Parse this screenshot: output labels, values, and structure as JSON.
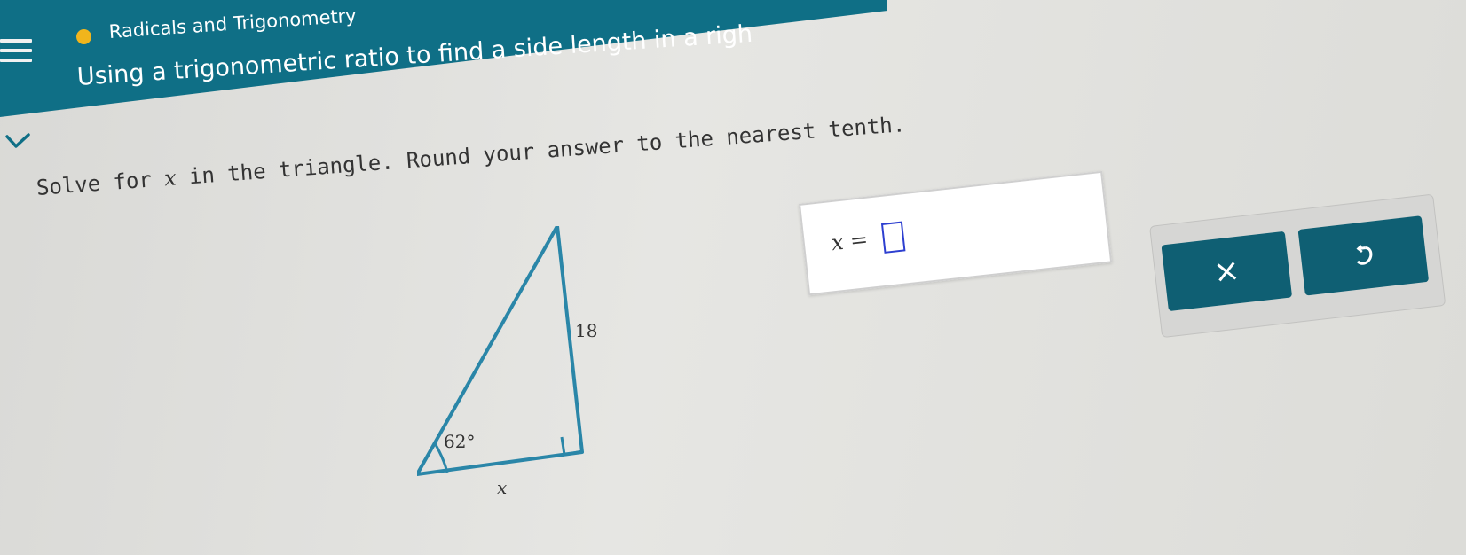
{
  "header": {
    "topic": "Radicals and Trigonometry",
    "subtitle": "Using a trigonometric ratio to find a side length in a righ"
  },
  "question": {
    "before": "Solve for ",
    "variable": "x",
    "after": " in the triangle. Round your answer to the nearest tenth."
  },
  "triangle": {
    "hypotenuse_label": "18",
    "angle_label": "62°",
    "base_label": "x"
  },
  "answer": {
    "label": "x =",
    "value": ""
  },
  "buttons": {
    "clear_icon": "close-icon",
    "undo_icon": "undo-icon"
  },
  "colors": {
    "header": "#0f6f86",
    "status_dot": "#f1b51c",
    "triangle": "#2a86a8",
    "button": "#0f5f73",
    "input_border": "#2d3fd0"
  }
}
